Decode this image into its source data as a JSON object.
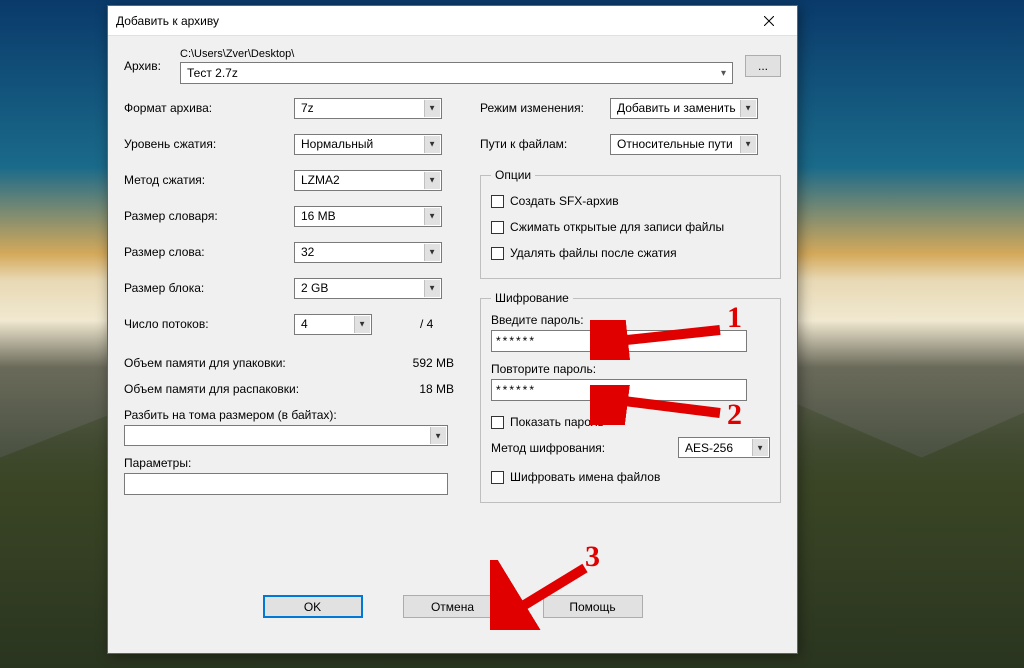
{
  "dialog": {
    "title": "Добавить к архиву",
    "archive_label": "Архив:",
    "archive_path": "C:\\Users\\Zver\\Desktop\\",
    "archive_name": "Тест 2.7z",
    "browse": "..."
  },
  "left": {
    "format_label": "Формат архива:",
    "format_value": "7z",
    "level_label": "Уровень сжатия:",
    "level_value": "Нормальный",
    "method_label": "Метод сжатия:",
    "method_value": "LZMA2",
    "dict_label": "Размер словаря:",
    "dict_value": "16 MB",
    "word_label": "Размер слова:",
    "word_value": "32",
    "block_label": "Размер блока:",
    "block_value": "2 GB",
    "threads_label": "Число потоков:",
    "threads_value": "4",
    "threads_max": "/ 4",
    "mem_pack_label": "Объем памяти для упаковки:",
    "mem_pack_value": "592 MB",
    "mem_unpack_label": "Объем памяти для распаковки:",
    "mem_unpack_value": "18 MB",
    "split_label": "Разбить на тома размером (в байтах):",
    "split_value": "",
    "params_label": "Параметры:",
    "params_value": ""
  },
  "right": {
    "update_label": "Режим изменения:",
    "update_value": "Добавить и заменить",
    "paths_label": "Пути к файлам:",
    "paths_value": "Относительные пути",
    "options_legend": "Опции",
    "opt_sfx": "Создать SFX-архив",
    "opt_shared": "Сжимать открытые для записи файлы",
    "opt_delete": "Удалять файлы после сжатия",
    "enc_legend": "Шифрование",
    "pw1_label": "Введите пароль:",
    "pw1_value": "******",
    "pw2_label": "Повторите пароль:",
    "pw2_value": "******",
    "show_pw": "Показать пароль",
    "enc_method_label": "Метод шифрования:",
    "enc_method_value": "AES-256",
    "enc_names": "Шифровать имена файлов"
  },
  "buttons": {
    "ok": "OK",
    "cancel": "Отмена",
    "help": "Помощь"
  },
  "annotations": {
    "n1": "1",
    "n2": "2",
    "n3": "3"
  }
}
